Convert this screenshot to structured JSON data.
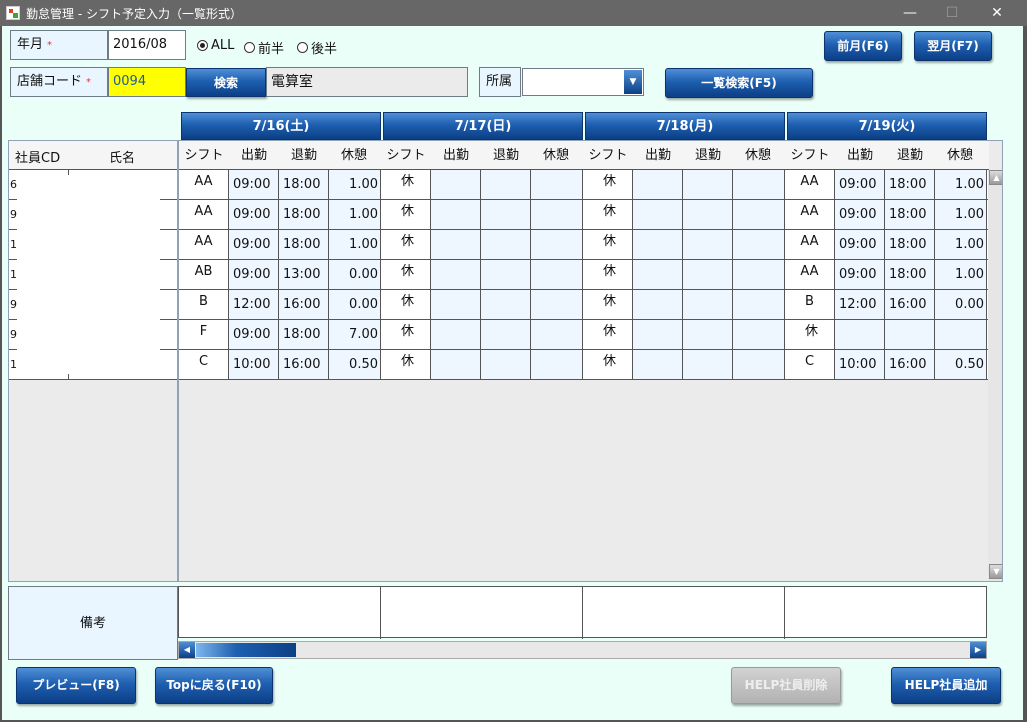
{
  "window": {
    "title": "勤怠管理 - シフト予定入力（一覧形式）",
    "minimize": "—",
    "maximize": "☐",
    "close": "✕"
  },
  "filters": {
    "year_month_label": "年月",
    "required_mark": "*",
    "year_month_value": "2016/08",
    "radio_all": "ALL",
    "radio_first": "前半",
    "radio_second": "後半",
    "selected_radio": "ALL",
    "store_code_label": "店舗コード",
    "store_code_value": "0094",
    "search_button": "検索",
    "store_name": "電算室",
    "dept_label": "所属",
    "dept_value": "",
    "list_search_button": "一覧検索(F5)",
    "prev_month_button": "前月(F6)",
    "next_month_button": "翌月(F7)"
  },
  "grid": {
    "left_headers": {
      "emp_cd": "社員CD",
      "name": "氏名"
    },
    "emp_cd_fragments": [
      "6",
      "9",
      "1",
      "1",
      "9",
      "9",
      "1"
    ],
    "day_columns": [
      "シフト",
      "出勤",
      "退勤",
      "休憩"
    ],
    "dates": [
      "7/16(土)",
      "7/17(日)",
      "7/18(月)",
      "7/19(火)"
    ],
    "rows": [
      [
        [
          "AA",
          "09:00",
          "18:00",
          "1.00"
        ],
        [
          "休",
          "",
          "",
          ""
        ],
        [
          "休",
          "",
          "",
          ""
        ],
        [
          "AA",
          "09:00",
          "18:00",
          "1.00"
        ]
      ],
      [
        [
          "AA",
          "09:00",
          "18:00",
          "1.00"
        ],
        [
          "休",
          "",
          "",
          ""
        ],
        [
          "休",
          "",
          "",
          ""
        ],
        [
          "AA",
          "09:00",
          "18:00",
          "1.00"
        ]
      ],
      [
        [
          "AA",
          "09:00",
          "18:00",
          "1.00"
        ],
        [
          "休",
          "",
          "",
          ""
        ],
        [
          "休",
          "",
          "",
          ""
        ],
        [
          "AA",
          "09:00",
          "18:00",
          "1.00"
        ]
      ],
      [
        [
          "AB",
          "09:00",
          "13:00",
          "0.00"
        ],
        [
          "休",
          "",
          "",
          ""
        ],
        [
          "休",
          "",
          "",
          ""
        ],
        [
          "AA",
          "09:00",
          "18:00",
          "1.00"
        ]
      ],
      [
        [
          "B",
          "12:00",
          "16:00",
          "0.00"
        ],
        [
          "休",
          "",
          "",
          ""
        ],
        [
          "休",
          "",
          "",
          ""
        ],
        [
          "B",
          "12:00",
          "16:00",
          "0.00"
        ]
      ],
      [
        [
          "F",
          "09:00",
          "18:00",
          "7.00"
        ],
        [
          "休",
          "",
          "",
          ""
        ],
        [
          "休",
          "",
          "",
          ""
        ],
        [
          "休",
          "",
          "",
          ""
        ]
      ],
      [
        [
          "C",
          "10:00",
          "16:00",
          "0.50"
        ],
        [
          "休",
          "",
          "",
          ""
        ],
        [
          "休",
          "",
          "",
          ""
        ],
        [
          "C",
          "10:00",
          "16:00",
          "0.50"
        ]
      ]
    ]
  },
  "remarks": {
    "label": "備考"
  },
  "footer": {
    "preview_button": "プレビュー(F8)",
    "top_button": "Topに戻る(F10)",
    "help_delete_button": "HELP社員削除",
    "help_add_button": "HELP社員追加"
  }
}
